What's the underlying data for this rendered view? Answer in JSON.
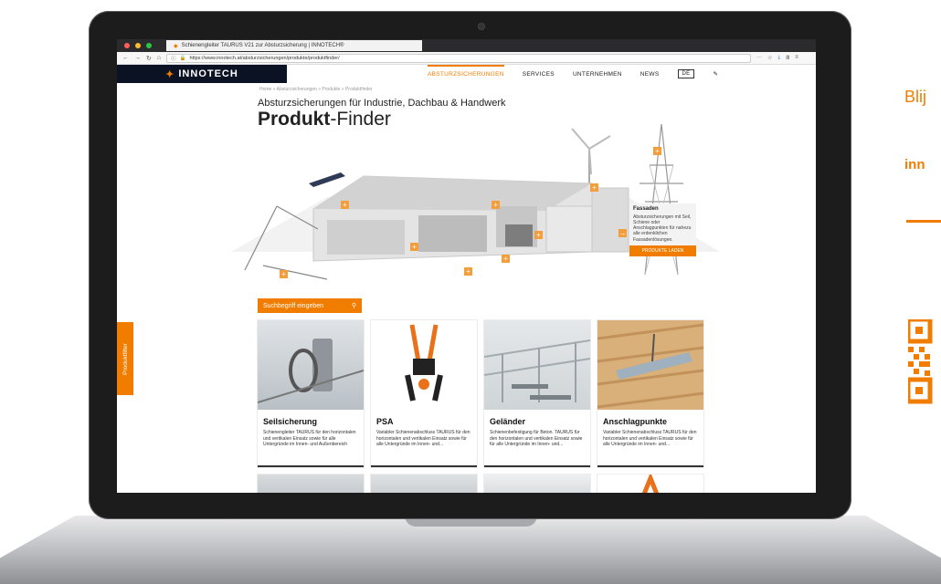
{
  "browser": {
    "tab_title": "Schienengleiter TAURUS V21 zur Absturzsicherung | INNOTECH®",
    "url": "https://www.innotech.at/absturzsicherungen/produkte/produktfinder/"
  },
  "header": {
    "logo": "INNOTECH",
    "nav": [
      "ABSTURZSICHERUNGEN",
      "SERVICES",
      "UNTERNEHMEN",
      "NEWS"
    ],
    "lang": "DE"
  },
  "breadcrumb": "Home » Absturzsicherungen » Produkte » Produktfinder",
  "hero": {
    "subtitle": "Absturzsicherungen für Industrie, Dachbau & Handwerk",
    "title_bold": "Produkt",
    "title_rest": "-Finder",
    "card_title": "Fassaden",
    "card_text": "Absturzsicherungen mit Seil, Schiene oder Anschlagpunkten für nahezu alle erdenklichen Fassadenlösungen.",
    "card_button": "PRODUKTE LADEN"
  },
  "search": {
    "placeholder": "Suchbegriff eingeben"
  },
  "sidefilter": "Produktfilter",
  "products": [
    {
      "title": "Seilsicherung",
      "text": "Schienengleiter TAURUS für den horizontalen und vertikalen Einsatz sowie für alle Untergründe im Innen- und Außenbereich"
    },
    {
      "title": "PSA",
      "text": "Variabler Schienenabschluss TAURUS für den horizontalen und vertikalen Einsatz sowie für alle Untergründe im Innen- und..."
    },
    {
      "title": "Geländer",
      "text": "Schienenbefestigung für Beton. TAURUS für den horizontalen und vertikalen Einsatz sowie für alle Untergründe im Innen- und..."
    },
    {
      "title": "Anschlagpunkte",
      "text": "Variabler Schienenabschluss TAURUS für den horizontalen und vertikalen Einsatz sowie für alle Untergründe im Innen- und..."
    }
  ],
  "right": {
    "line1": "Blij",
    "line2": "inn"
  },
  "colors": {
    "accent": "#f07d00",
    "dark": "#0b1224"
  }
}
